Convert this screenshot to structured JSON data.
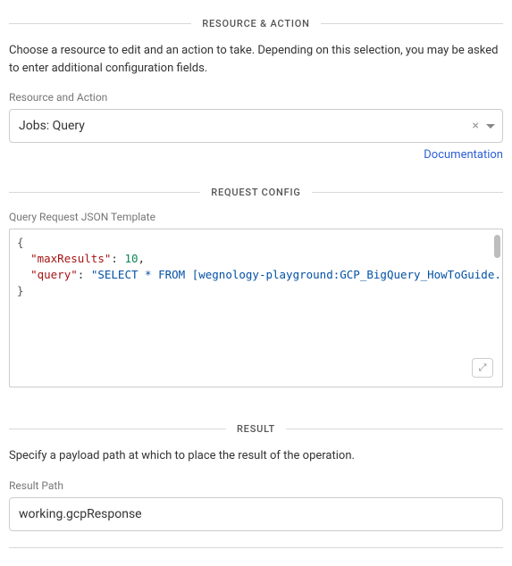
{
  "sections": {
    "resource_action": {
      "title": "RESOURCE & ACTION",
      "help": "Choose a resource to edit and an action to take. Depending on this selection, you may be asked to enter additional configuration fields.",
      "field_label": "Resource and Action",
      "selected_value": "Jobs: Query",
      "doc_link_label": "Documentation"
    },
    "request_config": {
      "title": "REQUEST CONFIG",
      "field_label": "Query Request JSON Template",
      "code": {
        "open_brace": "{",
        "line1_key": "\"maxResults\"",
        "line1_colon": ": ",
        "line1_value": "10",
        "line1_comma": ",",
        "line2_key": "\"query\"",
        "line2_colon": ": ",
        "line2_value": "\"SELECT * FROM [wegnology-playground:GCP_BigQuery_HowToGuide.Environme",
        "close_brace": "}"
      },
      "expand_glyph": "⤢"
    },
    "result": {
      "title": "RESULT",
      "help": "Specify a payload path at which to place the result of the operation.",
      "field_label": "Result Path",
      "value": "working.gcpResponse"
    }
  }
}
